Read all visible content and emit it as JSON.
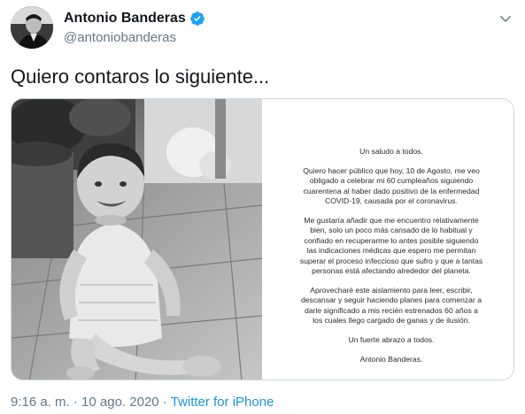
{
  "author": {
    "display_name": "Antonio Banderas",
    "handle": "@antoniobanderas",
    "avatar_icon": "avatar-photo",
    "verified_icon": "verified-badge-icon",
    "verified_color": "#1da1f2"
  },
  "menu_icon": "chevron-down-icon",
  "tweet_text": "Quiero contaros lo siguiente...",
  "letter": {
    "greeting": "Un saludo a todos.",
    "p1": [
      "Quiero hacer público que hoy, 10 de Agosto, me veo",
      "obligado a celebrar mi 60 cumpleaños siguiendo",
      "cuarentena al haber dado positivo de la enfermedad",
      "COVID-19, causada por el coronavirus."
    ],
    "p2": [
      "Me gustaría añadir que me encuentro relativamente",
      "bien, solo un poco más cansado de lo habitual y",
      "confiado en recuperarme lo antes posible siguiendo",
      "las indicaciones médicas que espero me permitan",
      "superar el proceso infeccioso que sufro y que a tantas",
      "personas está afectando alrededor del planeta."
    ],
    "p3": [
      "Aprovecharé este aislamiento para leer, escribir,",
      "descansar y seguir haciendo planes para comenzar a",
      "darle significado a mis recién estrenados 60 años a",
      "los cuales llego cargado de ganas y de ilusión."
    ],
    "closing": "Un fuerte abrazo a todos.",
    "signature": "Antonio Banderas."
  },
  "meta": {
    "time": "9:16 a. m.",
    "separator": " · ",
    "date": "10 ago. 2020",
    "source": "Twitter for iPhone"
  },
  "colors": {
    "text": "#14171a",
    "secondary": "#657786",
    "link": "#1b95e0",
    "border": "#ccd6dd"
  }
}
